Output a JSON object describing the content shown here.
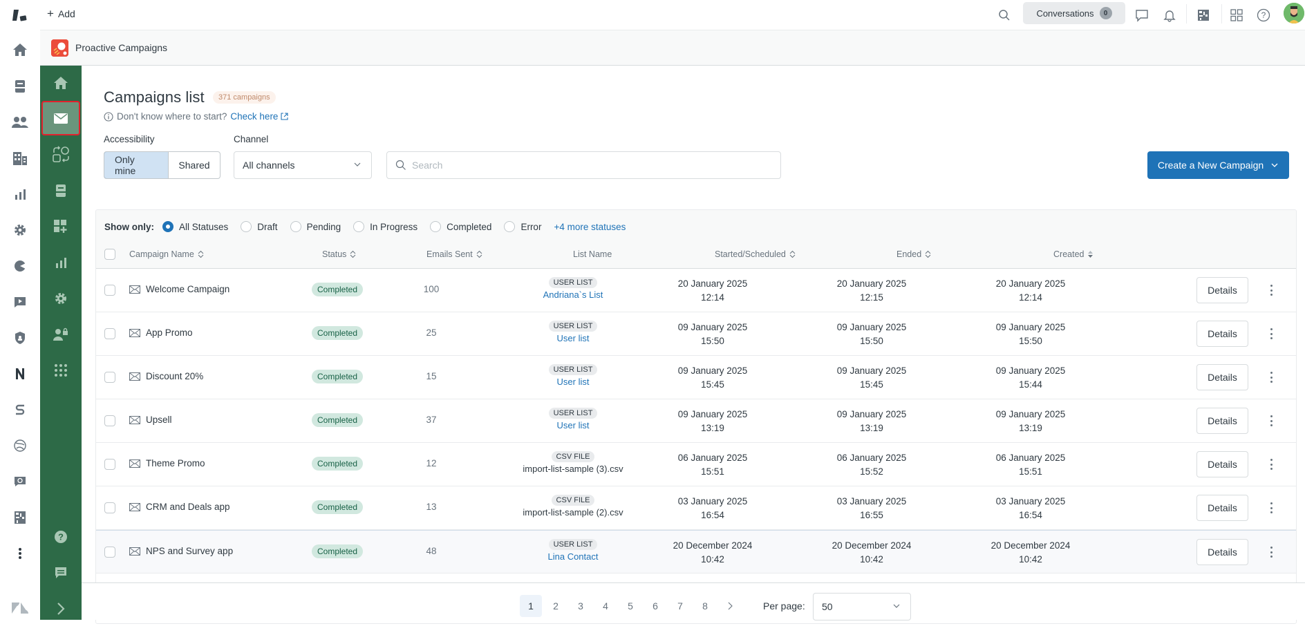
{
  "topbar": {
    "add_label": "Add",
    "conversations_label": "Conversations",
    "conversations_count": "0",
    "icons": [
      "search-icon",
      "chat-icon",
      "bell-icon",
      "qr-app-icon",
      "apps-grid-icon",
      "help-icon",
      "avatar"
    ]
  },
  "rail": {
    "icons": [
      "zendesk-logo-icon",
      "home-icon",
      "inbox-icon",
      "users-icon",
      "organizations-icon",
      "reports-icon",
      "settings-icon",
      "pie-app-icon",
      "video-app-icon",
      "shield-app-icon",
      "n-app-icon",
      "s-app-icon",
      "globe-app-icon",
      "chat-sync-icon",
      "qr-app-icon",
      "more-icon",
      "zendesk-footer-icon"
    ]
  },
  "app": {
    "title": "Proactive Campaigns",
    "accent": "#2d6a47"
  },
  "sidebar": {
    "items": [
      "home-icon",
      "mail-icon",
      "flows-icon",
      "inbox-icon",
      "add-widget-icon",
      "reports-icon",
      "settings-icon",
      "user-lock-icon",
      "apps-icon"
    ],
    "active": "mail-icon",
    "bottom": [
      "help-icon",
      "feedback-icon",
      "expand-icon"
    ]
  },
  "header": {
    "title": "Campaigns list",
    "count_badge": "371 campaigns",
    "hint_text": "Don't know where to start?",
    "hint_link": "Check here"
  },
  "filters": {
    "accessibility_label": "Accessibility",
    "only_mine": "Only mine",
    "shared": "Shared",
    "channel_label": "Channel",
    "channel_value": "All channels",
    "search_placeholder": "Search",
    "search_value": "",
    "create_button": "Create a New Campaign"
  },
  "status_filter": {
    "label": "Show only:",
    "options": [
      "All Statuses",
      "Draft",
      "Pending",
      "In Progress",
      "Completed",
      "Error"
    ],
    "selected": "All Statuses",
    "more_link": "+4 more statuses"
  },
  "table": {
    "columns": [
      "Campaign Name",
      "Status",
      "Emails Sent",
      "List Name",
      "Started/Scheduled",
      "Ended",
      "Created"
    ],
    "sorted_column": "Created",
    "details_label": "Details",
    "rows": [
      {
        "name": "Welcome Campaign",
        "status": "Completed",
        "emails_sent": "100",
        "list_type": "USER LIST",
        "list_name": "Andriana`s List",
        "list_link": true,
        "started_date": "20 January 2025",
        "started_time": "12:14",
        "ended_date": "20 January 2025",
        "ended_time": "12:15",
        "created_date": "20 January 2025",
        "created_time": "12:14"
      },
      {
        "name": "App Promo",
        "status": "Completed",
        "emails_sent": "25",
        "list_type": "USER LIST",
        "list_name": "User list",
        "list_link": true,
        "started_date": "09 January 2025",
        "started_time": "15:50",
        "ended_date": "09 January 2025",
        "ended_time": "15:50",
        "created_date": "09 January 2025",
        "created_time": "15:50"
      },
      {
        "name": "Discount 20%",
        "status": "Completed",
        "emails_sent": "15",
        "list_type": "USER LIST",
        "list_name": "User list",
        "list_link": true,
        "started_date": "09 January 2025",
        "started_time": "15:45",
        "ended_date": "09 January 2025",
        "ended_time": "15:45",
        "created_date": "09 January 2025",
        "created_time": "15:44"
      },
      {
        "name": "Upsell",
        "status": "Completed",
        "emails_sent": "37",
        "list_type": "USER LIST",
        "list_name": "User list",
        "list_link": true,
        "started_date": "09 January 2025",
        "started_time": "13:19",
        "ended_date": "09 January 2025",
        "ended_time": "13:19",
        "created_date": "09 January 2025",
        "created_time": "13:19"
      },
      {
        "name": "Theme Promo",
        "status": "Completed",
        "emails_sent": "12",
        "list_type": "CSV FILE",
        "list_name": "import-list-sample (3).csv",
        "list_link": false,
        "started_date": "06 January 2025",
        "started_time": "15:51",
        "ended_date": "06 January 2025",
        "ended_time": "15:52",
        "created_date": "06 January 2025",
        "created_time": "15:51"
      },
      {
        "name": "CRM and Deals app",
        "status": "Completed",
        "emails_sent": "13",
        "list_type": "CSV FILE",
        "list_name": "import-list-sample (2).csv",
        "list_link": false,
        "started_date": "03 January 2025",
        "started_time": "16:54",
        "ended_date": "03 January 2025",
        "ended_time": "16:55",
        "created_date": "03 January 2025",
        "created_time": "16:54"
      },
      {
        "name": "NPS and Survey app",
        "status": "Completed",
        "emails_sent": "48",
        "list_type": "USER LIST",
        "list_name": "Lina Contact",
        "list_link": true,
        "started_date": "20 December 2024",
        "started_time": "10:42",
        "ended_date": "20 December 2024",
        "ended_time": "10:42",
        "created_date": "20 December 2024",
        "created_time": "10:42"
      }
    ]
  },
  "pagination": {
    "pages": [
      "1",
      "2",
      "3",
      "4",
      "5",
      "6",
      "7",
      "8"
    ],
    "current": "1",
    "per_page_label": "Per page:",
    "per_page_value": "50"
  }
}
